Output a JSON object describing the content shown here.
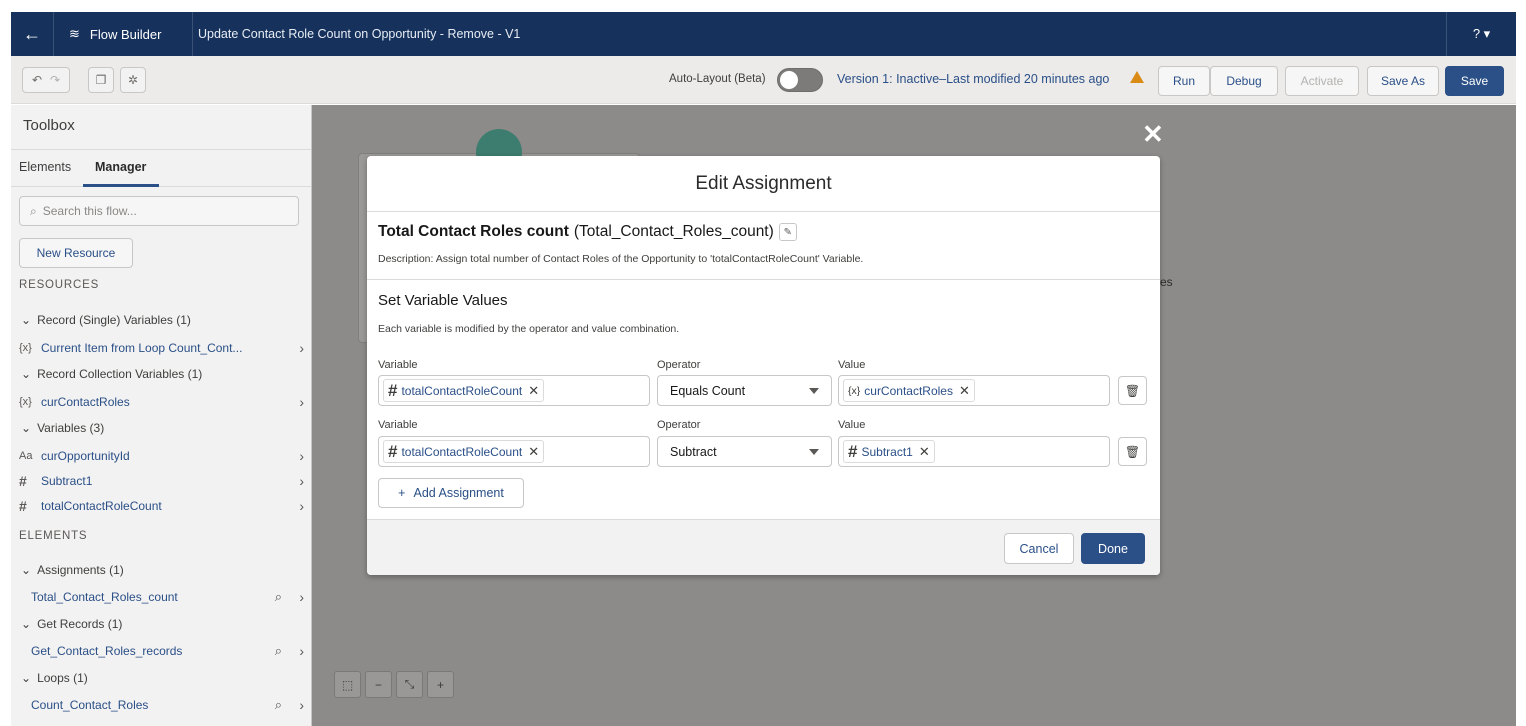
{
  "header": {
    "back_icon": "back-arrow-icon",
    "app_icon": "flow-icon",
    "app_name": "Flow Builder",
    "flow_title": "Update Contact Role Count on Opportunity - Remove - V1",
    "help_label": "? ▾"
  },
  "toolbar": {
    "undo_icon": "undo-icon",
    "redo_icon": "redo-icon",
    "copy_icon": "copy-icon",
    "settings_icon": "gear-icon",
    "auto_layout_label": "Auto-Layout (Beta)",
    "version_status": "Version 1: Inactive–Last modified 20 minutes ago",
    "warning_icon": "warning-icon",
    "run_label": "Run",
    "debug_label": "Debug",
    "activate_label": "Activate",
    "save_as_label": "Save As",
    "save_label": "Save"
  },
  "toolbox": {
    "title": "Toolbox",
    "tabs": [
      "Elements",
      "Manager"
    ],
    "active_tab": "Manager",
    "search_placeholder": "Search this flow...",
    "new_resource_label": "New Resource",
    "resources_heading": "RESOURCES",
    "groups": [
      {
        "label": "Record (Single) Variables (1)",
        "items": [
          {
            "icon": "{x}",
            "label": "Current Item from Loop Count_Cont..."
          }
        ]
      },
      {
        "label": "Record Collection Variables (1)",
        "items": [
          {
            "icon": "{x}",
            "label": "curContactRoles"
          }
        ]
      },
      {
        "label": "Variables (3)",
        "items": [
          {
            "icon": "Aa",
            "label": "curOpportunityId"
          },
          {
            "icon": "#",
            "label": "Subtract1"
          },
          {
            "icon": "#",
            "label": "totalContactRoleCount"
          }
        ]
      }
    ],
    "elements_heading": "ELEMENTS",
    "element_groups": [
      {
        "label": "Assignments (1)",
        "items": [
          {
            "label": "Total_Contact_Roles_count"
          }
        ]
      },
      {
        "label": "Get Records (1)",
        "items": [
          {
            "label": "Get_Contact_Roles_records"
          }
        ]
      },
      {
        "label": "Loops (1)",
        "items": [
          {
            "label": "Count_Contact_Roles"
          }
        ]
      }
    ]
  },
  "canvas": {
    "partial_text": "es"
  },
  "modal": {
    "title": "Edit Assignment",
    "name_label": "Total Contact Roles count",
    "api_name": "(Total_Contact_Roles_count)",
    "description": "Description: Assign total number of Contact Roles of the Opportunity to 'totalContactRoleCount' Variable.",
    "section_title": "Set Variable Values",
    "section_desc": "Each variable is modified by the operator and value combination.",
    "labels": {
      "variable": "Variable",
      "operator": "Operator",
      "value": "Value"
    },
    "rows": [
      {
        "variable": "totalContactRoleCount",
        "operator": "Equals Count",
        "value": "curContactRoles",
        "value_icon": "{x}"
      },
      {
        "variable": "totalContactRoleCount",
        "operator": "Subtract",
        "value": "Subtract1",
        "value_icon": "#"
      }
    ],
    "add_label": "Add Assignment",
    "cancel_label": "Cancel",
    "done_label": "Done"
  },
  "colors": {
    "nav": "#16325c",
    "brand": "#2b4f87",
    "link": "#2a4f87",
    "warning": "#d98b16"
  }
}
